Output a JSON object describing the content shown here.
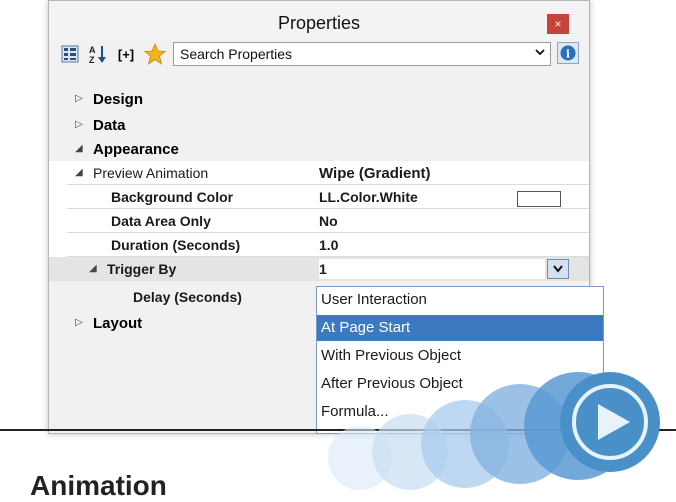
{
  "window": {
    "title": "Properties",
    "close_glyph": "×"
  },
  "toolbar": {
    "icons": [
      "categorized-icon",
      "sort-az-icon",
      "formula-icon",
      "favorite-star-icon"
    ],
    "formula_label": "[+]",
    "search_placeholder": "Search Properties",
    "info_glyph": "i"
  },
  "grid": {
    "categories": [
      {
        "label": "Design"
      },
      {
        "label": "Data"
      },
      {
        "label": "Appearance"
      },
      {
        "label": "Layout"
      }
    ],
    "properties": [
      {
        "label": "Preview Animation",
        "value": "Wipe (Gradient)"
      },
      {
        "label": "Background Color",
        "value": "LL.Color.White"
      },
      {
        "label": "Data Area Only",
        "value": "No"
      },
      {
        "label": "Duration (Seconds)",
        "value": "1.0"
      },
      {
        "label": "Trigger By",
        "value": "1"
      },
      {
        "label": "Delay (Seconds)",
        "value": ""
      }
    ]
  },
  "dropdown": {
    "options": [
      "User Interaction",
      "At Page Start",
      "With Previous Object",
      "After Previous Object",
      "Formula..."
    ],
    "selected": "At Page Start"
  },
  "footer": {
    "heading": "Animation"
  },
  "colors": {
    "accent": "#3b7ac0",
    "close": "#c8413a",
    "decor_circle": "#4a90c8"
  }
}
